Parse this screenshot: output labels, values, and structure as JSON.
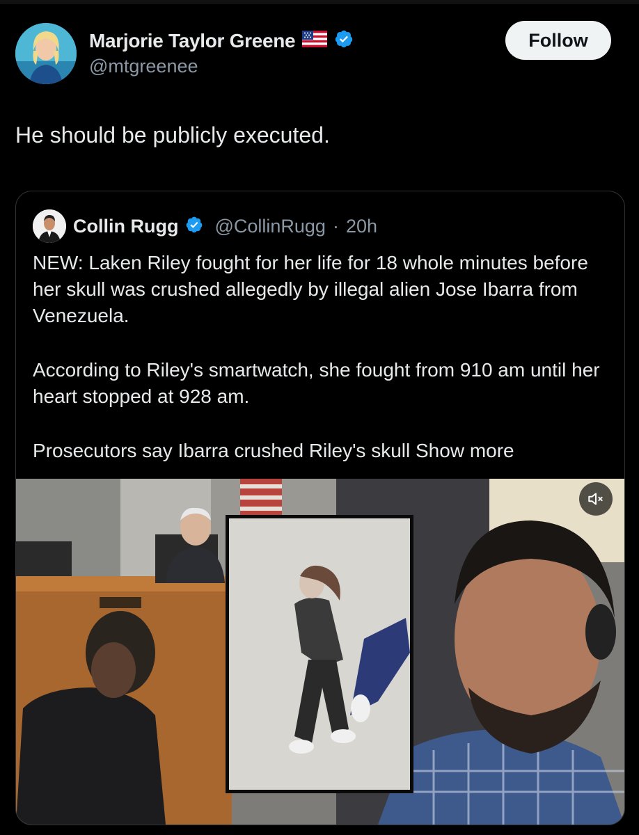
{
  "post": {
    "author_name": "Marjorie Taylor Greene",
    "author_handle": "@mtgreenee",
    "follow_label": "Follow",
    "text": "He should be publicly executed."
  },
  "quoted": {
    "author_name": "Collin Rugg",
    "author_handle": "@CollinRugg",
    "separator": "·",
    "time": "20h",
    "paragraphs": [
      "NEW: Laken Riley fought for her life for 18 whole minutes before her skull was crushed allegedly by illegal alien Jose Ibarra from Venezuela.",
      "According to Riley's smartwatch, she fought from 910 am until her heart stopped at 928 am.",
      "Prosecutors say Ibarra crushed Riley's skull"
    ],
    "show_more": "Show more"
  },
  "icons": {
    "flag": "us-flag-icon",
    "verified": "verified-badge-icon",
    "mute": "volume-muted-icon"
  },
  "colors": {
    "background": "#000000",
    "text": "#e7e9ea",
    "secondary_text": "#8b98a5",
    "verified": "#1d9bf0",
    "follow_bg": "#eff3f4"
  }
}
